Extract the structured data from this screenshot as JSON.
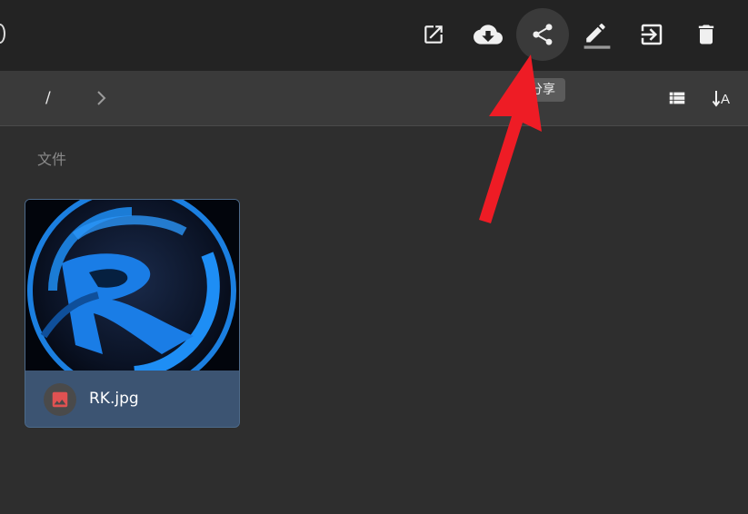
{
  "toolbar": {
    "buttons": [
      {
        "id": "open",
        "icon": "open-in-new-icon"
      },
      {
        "id": "download",
        "icon": "cloud-download-icon"
      },
      {
        "id": "share",
        "icon": "share-icon",
        "active": true
      },
      {
        "id": "rename",
        "icon": "pencil-icon"
      },
      {
        "id": "move",
        "icon": "move-to-icon"
      },
      {
        "id": "delete",
        "icon": "trash-icon"
      }
    ],
    "tooltip": "分享"
  },
  "breadcrumb": {
    "root": "/"
  },
  "view_controls": {
    "list_icon": "list-view-icon",
    "sort_icon": "sort-alpha-icon",
    "sort_letter": "A"
  },
  "files_section": {
    "title": "文件",
    "items": [
      {
        "name": "RK.jpg",
        "type_icon": "image-icon",
        "selected": true
      }
    ]
  },
  "colors": {
    "toolbar_bg": "#232323",
    "pathbar_bg": "#3a3a3a",
    "page_bg": "#2e2e2e",
    "selected_card": "#3c5472",
    "image_icon": "#e05252",
    "annotation_arrow": "#ee1c25"
  }
}
